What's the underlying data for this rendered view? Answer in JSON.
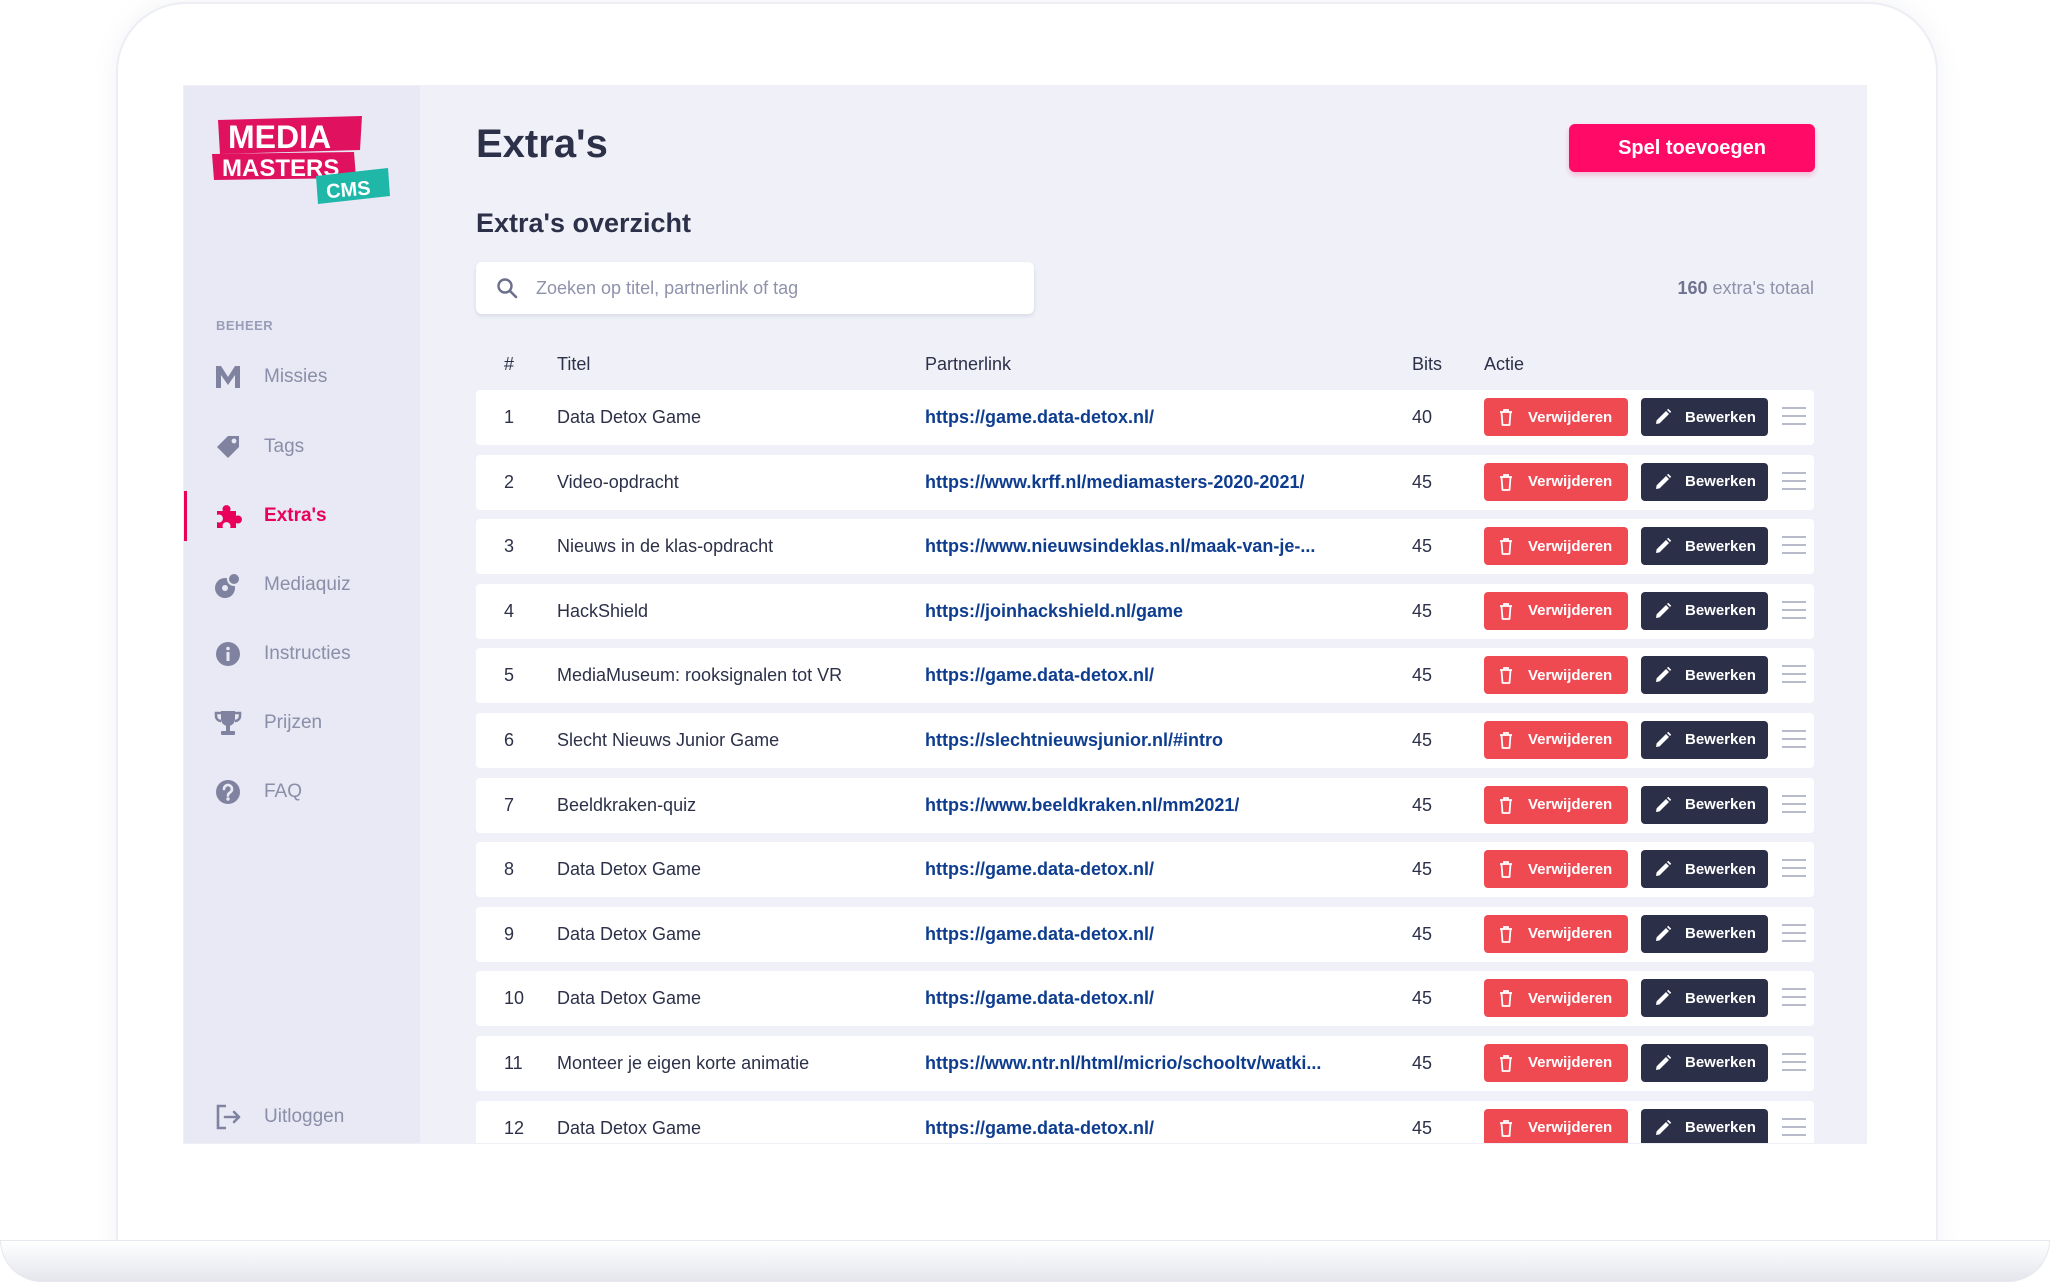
{
  "brand": {
    "logo_line1": "MEDIA",
    "logo_line2": "MASTERS",
    "logo_badge": "CMS",
    "colors": {
      "accent": "#ff0a67",
      "logo_red": "#e0115f",
      "logo_teal": "#1fb8a8",
      "navy": "#0e3d8f",
      "delete_red": "#ef4a52",
      "edit_dark": "#2b2f48"
    }
  },
  "sidebar": {
    "section_label": "BEHEER",
    "items": [
      {
        "label": "Missies",
        "icon": "m-letter-icon",
        "active": false
      },
      {
        "label": "Tags",
        "icon": "tag-icon",
        "active": false
      },
      {
        "label": "Extra's",
        "icon": "puzzle-icon",
        "active": true
      },
      {
        "label": "Mediaquiz",
        "icon": "quiz-icon",
        "active": false
      },
      {
        "label": "Instructies",
        "icon": "info-icon",
        "active": false
      },
      {
        "label": "Prijzen",
        "icon": "trophy-icon",
        "active": false
      },
      {
        "label": "FAQ",
        "icon": "question-icon",
        "active": false
      }
    ],
    "logout_label": "Uitloggen"
  },
  "page": {
    "title": "Extra's",
    "add_button": "Spel toevoegen",
    "subtitle": "Extra's overzicht",
    "search_placeholder": "Zoeken op titel, partnerlink of tag",
    "total_count": "160",
    "total_suffix": " extra's totaal"
  },
  "table": {
    "headers": {
      "num": "#",
      "title": "Titel",
      "link": "Partnerlink",
      "bits": "Bits",
      "action": "Actie"
    },
    "delete_label": "Verwijderen",
    "edit_label": "Bewerken",
    "rows": [
      {
        "num": "1",
        "title": "Data Detox Game",
        "link": "https://game.data-detox.nl/",
        "bits": "40"
      },
      {
        "num": "2",
        "title": "Video-opdracht",
        "link": "https://www.krff.nl/mediamasters-2020-2021/",
        "bits": "45"
      },
      {
        "num": "3",
        "title": "Nieuws in de klas-opdracht",
        "link": "https://www.nieuwsindeklas.nl/maak-van-je-...",
        "bits": "45"
      },
      {
        "num": "4",
        "title": "HackShield",
        "link": "https://joinhackshield.nl/game",
        "bits": "45"
      },
      {
        "num": "5",
        "title": "MediaMuseum: rooksignalen tot VR",
        "link": "https://game.data-detox.nl/",
        "bits": "45"
      },
      {
        "num": "6",
        "title": "Slecht Nieuws Junior Game",
        "link": "https://slechtnieuwsjunior.nl/#intro",
        "bits": "45"
      },
      {
        "num": "7",
        "title": "Beeldkraken-quiz",
        "link": "https://www.beeldkraken.nl/mm2021/",
        "bits": "45"
      },
      {
        "num": "8",
        "title": "Data Detox Game",
        "link": "https://game.data-detox.nl/",
        "bits": "45"
      },
      {
        "num": "9",
        "title": "Data Detox Game",
        "link": "https://game.data-detox.nl/",
        "bits": "45"
      },
      {
        "num": "10",
        "title": "Data Detox Game",
        "link": "https://game.data-detox.nl/",
        "bits": "45"
      },
      {
        "num": "11",
        "title": "Monteer je eigen korte animatie",
        "link": "https://www.ntr.nl/html/micrio/schooltv/watki...",
        "bits": "45"
      },
      {
        "num": "12",
        "title": "Data Detox Game",
        "link": "https://game.data-detox.nl/",
        "bits": "45"
      }
    ]
  }
}
